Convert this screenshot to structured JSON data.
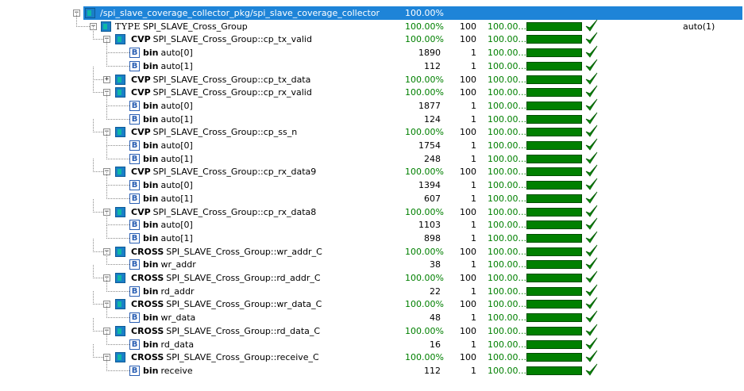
{
  "colors": {
    "selection": "#1e84d8",
    "coverage_green": "#008000",
    "bar_green": "#008000"
  },
  "rows": [
    {
      "depth": 0,
      "exp": "minus",
      "icon": "group",
      "kind": "",
      "name": "/spi_slave_coverage_collector_pkg/spi_slave_coverage_collector",
      "pct": "100.00%",
      "selected": true
    },
    {
      "depth": 1,
      "exp": "minus",
      "icon": "group",
      "kind": "TYPE",
      "name": "SPI_SLAVE_Cross_Group",
      "pct": "100.00%",
      "goal": "100",
      "prog": "100.00...",
      "check": true,
      "opts": "auto(1)"
    },
    {
      "depth": 2,
      "exp": "minus",
      "icon": "group",
      "kind": "CVP",
      "name": "SPI_SLAVE_Cross_Group::cp_tx_valid",
      "pct": "100.00%",
      "goal": "100",
      "prog": "100.00...",
      "check": true
    },
    {
      "depth": 3,
      "icon": "bin",
      "kind": "bin",
      "name": "auto[0]",
      "hits": "1890",
      "goal": "1",
      "prog": "100.00...",
      "check": true
    },
    {
      "depth": 3,
      "icon": "bin",
      "kind": "bin",
      "name": "auto[1]",
      "hits": "112",
      "goal": "1",
      "prog": "100.00...",
      "check": true
    },
    {
      "depth": 2,
      "exp": "plus",
      "icon": "group",
      "kind": "CVP",
      "name": "SPI_SLAVE_Cross_Group::cp_tx_data",
      "pct": "100.00%",
      "goal": "100",
      "prog": "100.00...",
      "check": true
    },
    {
      "depth": 2,
      "exp": "minus",
      "icon": "group",
      "kind": "CVP",
      "name": "SPI_SLAVE_Cross_Group::cp_rx_valid",
      "pct": "100.00%",
      "goal": "100",
      "prog": "100.00...",
      "check": true
    },
    {
      "depth": 3,
      "icon": "bin",
      "kind": "bin",
      "name": "auto[0]",
      "hits": "1877",
      "goal": "1",
      "prog": "100.00...",
      "check": true
    },
    {
      "depth": 3,
      "icon": "bin",
      "kind": "bin",
      "name": "auto[1]",
      "hits": "124",
      "goal": "1",
      "prog": "100.00...",
      "check": true
    },
    {
      "depth": 2,
      "exp": "minus",
      "icon": "group",
      "kind": "CVP",
      "name": "SPI_SLAVE_Cross_Group::cp_ss_n",
      "pct": "100.00%",
      "goal": "100",
      "prog": "100.00...",
      "check": true
    },
    {
      "depth": 3,
      "icon": "bin",
      "kind": "bin",
      "name": "auto[0]",
      "hits": "1754",
      "goal": "1",
      "prog": "100.00...",
      "check": true
    },
    {
      "depth": 3,
      "icon": "bin",
      "kind": "bin",
      "name": "auto[1]",
      "hits": "248",
      "goal": "1",
      "prog": "100.00...",
      "check": true
    },
    {
      "depth": 2,
      "exp": "minus",
      "icon": "group",
      "kind": "CVP",
      "name": "SPI_SLAVE_Cross_Group::cp_rx_data9",
      "pct": "100.00%",
      "goal": "100",
      "prog": "100.00...",
      "check": true
    },
    {
      "depth": 3,
      "icon": "bin",
      "kind": "bin",
      "name": "auto[0]",
      "hits": "1394",
      "goal": "1",
      "prog": "100.00...",
      "check": true
    },
    {
      "depth": 3,
      "icon": "bin",
      "kind": "bin",
      "name": "auto[1]",
      "hits": "607",
      "goal": "1",
      "prog": "100.00...",
      "check": true
    },
    {
      "depth": 2,
      "exp": "minus",
      "icon": "group",
      "kind": "CVP",
      "name": "SPI_SLAVE_Cross_Group::cp_rx_data8",
      "pct": "100.00%",
      "goal": "100",
      "prog": "100.00...",
      "check": true
    },
    {
      "depth": 3,
      "icon": "bin",
      "kind": "bin",
      "name": "auto[0]",
      "hits": "1103",
      "goal": "1",
      "prog": "100.00...",
      "check": true
    },
    {
      "depth": 3,
      "icon": "bin",
      "kind": "bin",
      "name": "auto[1]",
      "hits": "898",
      "goal": "1",
      "prog": "100.00...",
      "check": true
    },
    {
      "depth": 2,
      "exp": "minus",
      "icon": "group",
      "kind": "CROSS",
      "name": "SPI_SLAVE_Cross_Group::wr_addr_C",
      "pct": "100.00%",
      "goal": "100",
      "prog": "100.00...",
      "check": true
    },
    {
      "depth": 3,
      "icon": "bin",
      "kind": "bin",
      "name": "wr_addr",
      "hits": "38",
      "goal": "1",
      "prog": "100.00...",
      "check": true
    },
    {
      "depth": 2,
      "exp": "minus",
      "icon": "group",
      "kind": "CROSS",
      "name": "SPI_SLAVE_Cross_Group::rd_addr_C",
      "pct": "100.00%",
      "goal": "100",
      "prog": "100.00...",
      "check": true
    },
    {
      "depth": 3,
      "icon": "bin",
      "kind": "bin",
      "name": "rd_addr",
      "hits": "22",
      "goal": "1",
      "prog": "100.00...",
      "check": true
    },
    {
      "depth": 2,
      "exp": "minus",
      "icon": "group",
      "kind": "CROSS",
      "name": "SPI_SLAVE_Cross_Group::wr_data_C",
      "pct": "100.00%",
      "goal": "100",
      "prog": "100.00...",
      "check": true
    },
    {
      "depth": 3,
      "icon": "bin",
      "kind": "bin",
      "name": "wr_data",
      "hits": "48",
      "goal": "1",
      "prog": "100.00...",
      "check": true
    },
    {
      "depth": 2,
      "exp": "minus",
      "icon": "group",
      "kind": "CROSS",
      "name": "SPI_SLAVE_Cross_Group::rd_data_C",
      "pct": "100.00%",
      "goal": "100",
      "prog": "100.00...",
      "check": true
    },
    {
      "depth": 3,
      "icon": "bin",
      "kind": "bin",
      "name": "rd_data",
      "hits": "16",
      "goal": "1",
      "prog": "100.00...",
      "check": true
    },
    {
      "depth": 2,
      "exp": "minus",
      "icon": "group",
      "kind": "CROSS",
      "name": "SPI_SLAVE_Cross_Group::receive_C",
      "pct": "100.00%",
      "goal": "100",
      "prog": "100.00...",
      "check": true
    },
    {
      "depth": 3,
      "icon": "bin",
      "kind": "bin",
      "name": "receive",
      "hits": "112",
      "goal": "1",
      "prog": "100.00...",
      "check": true
    }
  ]
}
